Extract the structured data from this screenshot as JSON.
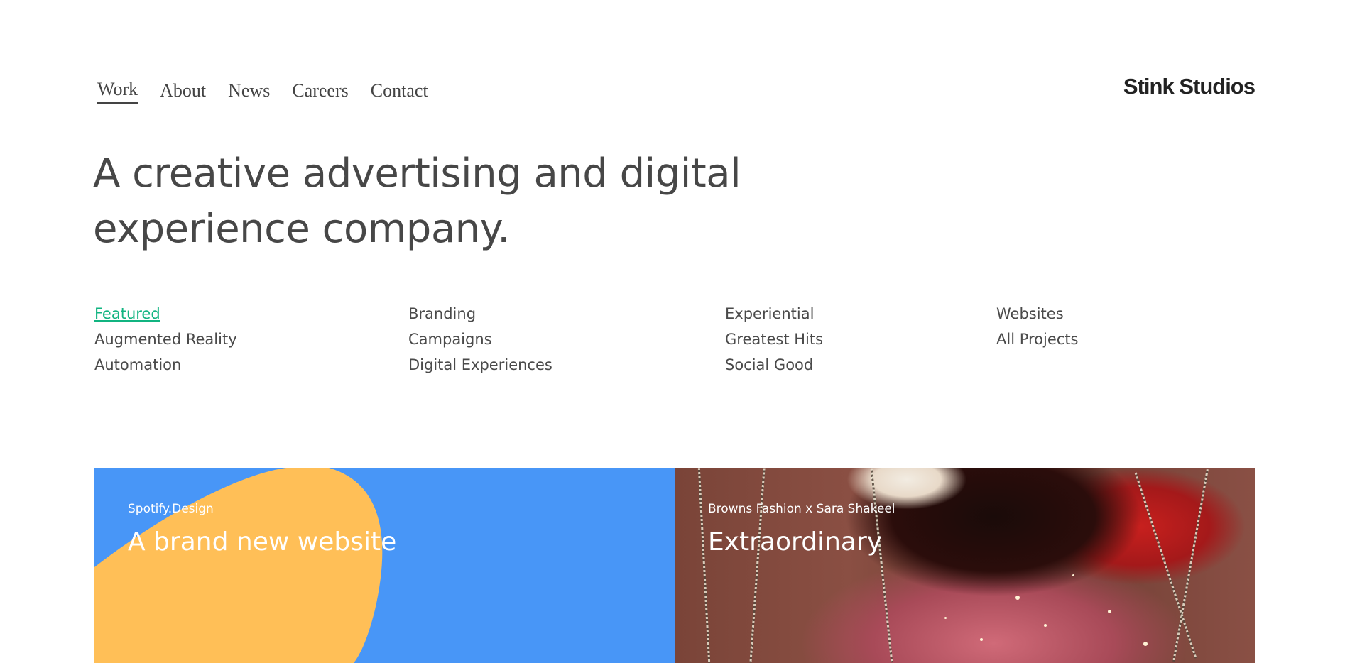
{
  "nav": {
    "items": [
      "Work",
      "About",
      "News",
      "Careers",
      "Contact"
    ],
    "active": "Work"
  },
  "logo": "Stink Studios",
  "headline": "A creative advertising and digital experience company.",
  "filters": {
    "columns": [
      [
        "Featured",
        "Augmented Reality",
        "Automation"
      ],
      [
        "Branding",
        "Campaigns",
        "Digital Experiences"
      ],
      [
        "Experiential",
        "Greatest Hits",
        "Social Good"
      ],
      [
        "Websites",
        "All Projects"
      ]
    ],
    "active": "Featured",
    "active_color": "#11b481"
  },
  "tiles": [
    {
      "client": "Spotify.Design",
      "title": "A brand new website",
      "bg_color": "#4896f7",
      "shape_color": "#ffbf57"
    },
    {
      "client": "Browns Fashion x Sara Shakeel",
      "title": "Extraordinary"
    }
  ]
}
